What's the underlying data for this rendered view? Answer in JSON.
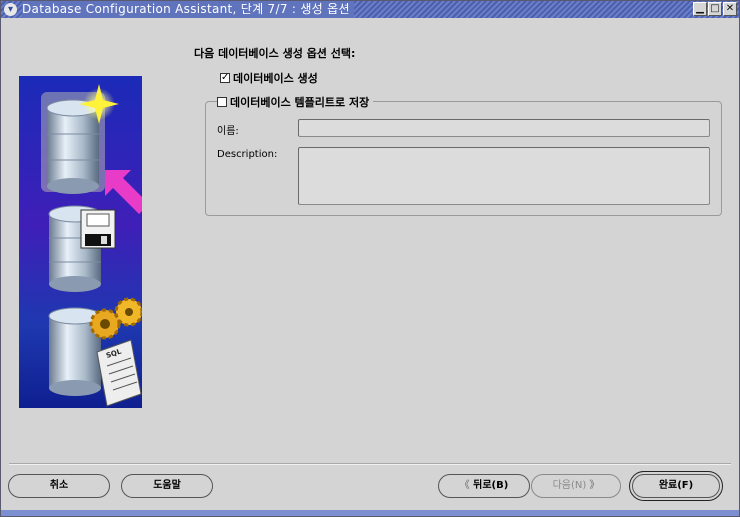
{
  "window": {
    "title": "Database Configuration Assistant, 단계 7/7 : 생성 옵션",
    "controls": {
      "menu": "▾",
      "minimize": "▁",
      "maximize": "□",
      "close": "✕"
    }
  },
  "main": {
    "heading": "다음 데이터베이스 생성 옵션 선택:",
    "create_database": {
      "label": "데이터베이스 생성",
      "checked": true,
      "mark": "✓"
    },
    "save_template": {
      "label": "데이터베이스 템플리트로 저장",
      "checked": false,
      "mark": ""
    },
    "template_group": {
      "name_label": "이름:",
      "name_value": "",
      "description_label": "Description:",
      "description_value": ""
    }
  },
  "buttons": {
    "cancel": "취소",
    "help": "도움말",
    "back_arrow": "《",
    "back": "뒤로(B)",
    "next": "다음(N)",
    "next_arrow": "》",
    "finish": "완료(F)"
  },
  "illustration": {
    "sql_label": "SQL"
  },
  "colors": {
    "titlebar": "#5a6fbe",
    "panel_bg": "#d4d4d4",
    "illustration_bg": "#2a2ab8",
    "arrow": "#e83cc8"
  }
}
